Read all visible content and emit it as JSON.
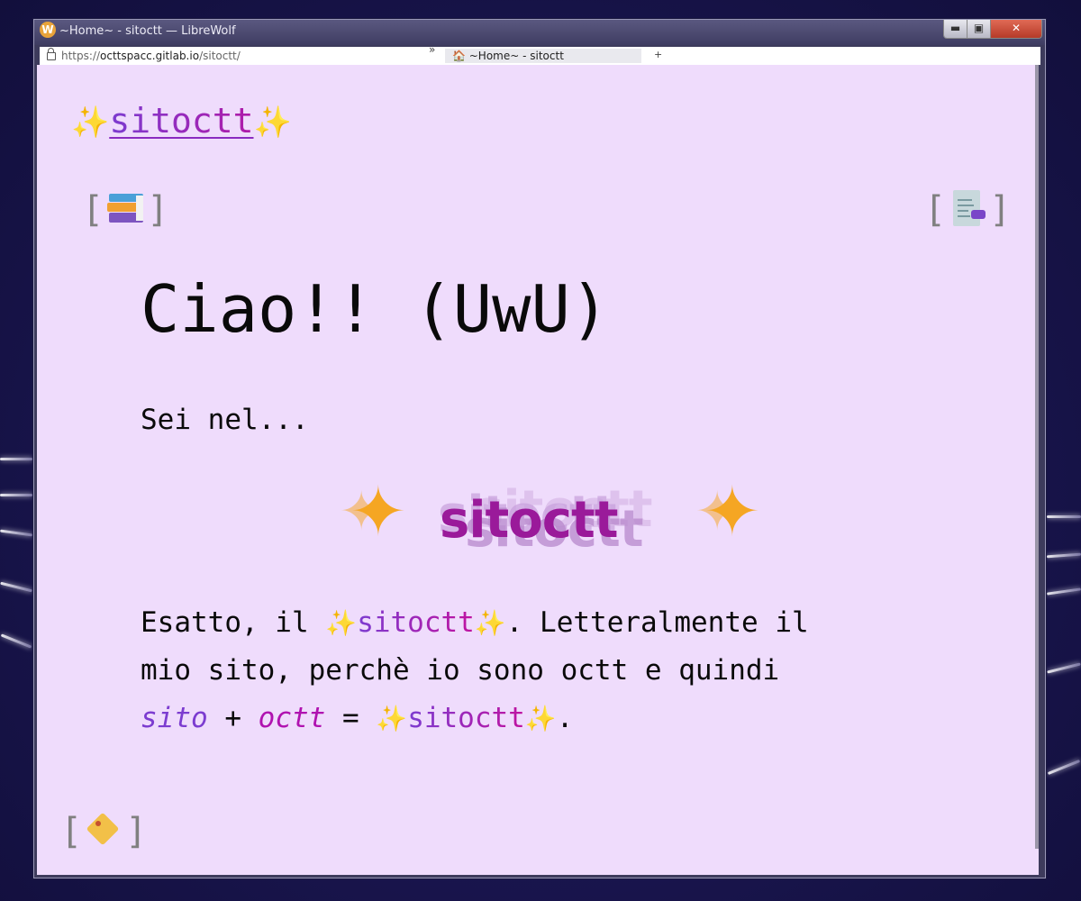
{
  "window": {
    "title": "~Home~ - sitoctt — LibreWolf",
    "app_icon_letter": "W"
  },
  "toolbar": {
    "url_proto": "https://",
    "url_host": "octtspacc.gitlab.io",
    "url_path": "/sitoctt/",
    "overflow_chevron": "»",
    "tab_label": "🏠 ~Home~ - sitoctt",
    "new_tab": "+"
  },
  "site": {
    "logo_spark": "✨",
    "logo_text": "sitoctt",
    "nav_left_bracket_open": "[",
    "nav_left_bracket_close": "]",
    "nav_left_icon": "books-icon",
    "nav_right_icon": "document-pen-icon",
    "footer_icon": "tag-icon"
  },
  "content": {
    "heading": "Ciao!! (UwU)",
    "intro": "Sei nel...",
    "banner_text": "sitoctt",
    "p1_a": "Esatto, il ",
    "p1_logo": "sitoctt",
    "p1_b": ". Letteralmente il",
    "p2": "mio sito, perchè io sono octt e quindi",
    "p3_sito": "sito",
    "p3_plus": " + ",
    "p3_octt": "octt",
    "p3_eq": " = ",
    "p3_logo": "sitoctt",
    "p3_end": "."
  },
  "colors": {
    "page_bg": "#efdcfc",
    "accent_purple": "#7c3cd0",
    "accent_magenta": "#b012b0",
    "sparkle": "#f5a623"
  }
}
